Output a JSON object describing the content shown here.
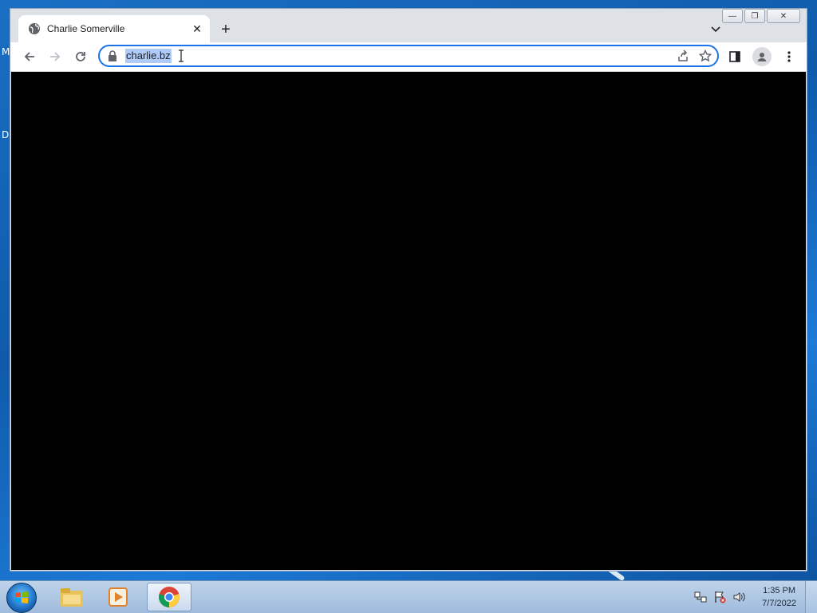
{
  "desktop": {
    "labels": [
      "M",
      "D"
    ]
  },
  "browser": {
    "tab": {
      "title": "Charlie Somerville",
      "favicon": "globe-icon",
      "close_icon": "close-icon"
    },
    "new_tab_icon": "plus-icon",
    "tab_search_icon": "chevron-down-icon",
    "window_controls": {
      "minimize": "minimize-icon",
      "restore": "restore-icon",
      "close": "close-icon"
    },
    "toolbar": {
      "back_icon": "back-arrow-icon",
      "forward_icon": "forward-arrow-icon",
      "reload_icon": "reload-icon",
      "address": {
        "lock_icon": "lock-icon",
        "url": "charlie.bz",
        "selected": true
      },
      "share_icon": "share-icon",
      "bookmark_icon": "star-icon",
      "side_panel_icon": "side-panel-icon",
      "profile_icon": "profile-icon",
      "menu_icon": "kebab-menu-icon"
    },
    "content_background": "#000000"
  },
  "taskbar": {
    "start_icon": "windows-start-icon",
    "items": [
      {
        "icon": "file-explorer-icon",
        "active": false
      },
      {
        "icon": "media-player-icon",
        "active": false
      },
      {
        "icon": "chrome-icon",
        "active": true
      }
    ],
    "tray_icons": [
      "network-icon",
      "action-center-flag-icon",
      "volume-icon"
    ],
    "clock": {
      "time": "1:35 PM",
      "date": "7/7/2022"
    }
  },
  "colors": {
    "accent": "#1a73e8",
    "selection": "#aecbfa",
    "desktop": "#1565c0"
  }
}
